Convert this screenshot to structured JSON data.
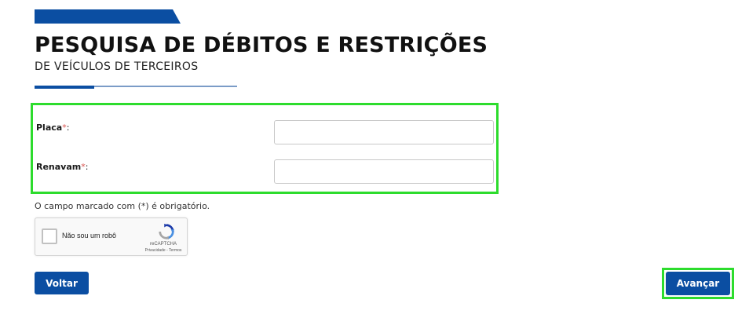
{
  "header": {
    "title": "PESQUISA DE DÉBITOS E RESTRIÇÕES",
    "subtitle": "DE VEÍCULOS DE TERCEIROS"
  },
  "form": {
    "fields": [
      {
        "label": "Placa",
        "required_mark": "*",
        "suffix": ":",
        "value": "",
        "placeholder": ""
      },
      {
        "label": "Renavam",
        "required_mark": "*",
        "suffix": ":",
        "value": "",
        "placeholder": ""
      }
    ],
    "required_note": "O campo marcado com (*) é obrigatório."
  },
  "captcha": {
    "label": "Não sou um robô",
    "brand": "reCAPTCHA",
    "links": "Privacidade - Termos",
    "checked": false
  },
  "actions": {
    "back_label": "Voltar",
    "next_label": "Avançar"
  },
  "colors": {
    "brand_blue": "#0b4ea2",
    "highlight_green": "#2ddc2d",
    "required_red": "#d9534f"
  }
}
